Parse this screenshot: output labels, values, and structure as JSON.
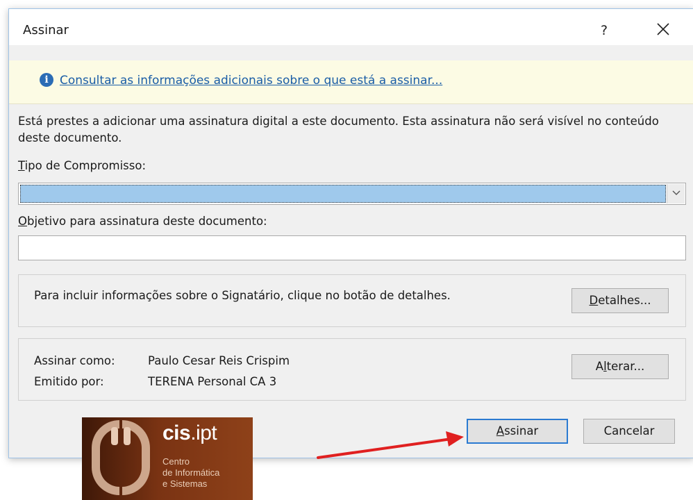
{
  "dialog": {
    "title": "Assinar",
    "help_label": "?"
  },
  "infobar": {
    "link_text": "Consultar as informações adicionais sobre o que está a assinar..."
  },
  "description": "Está prestes a adicionar uma assinatura digital a este documento. Esta assinatura não será visível no conteúdo deste documento.",
  "commitment": {
    "label_accel": "T",
    "label_rest": "ipo de Compromisso:",
    "value": ""
  },
  "purpose": {
    "label_accel": "O",
    "label_rest": "bjetivo para assinatura deste documento:",
    "value": ""
  },
  "signer_details": {
    "text": "Para incluir informações sobre o Signatário, clique no botão de detalhes.",
    "button_accel": "D",
    "button_rest": "etalhes..."
  },
  "certificate": {
    "sign_as_label": "Assinar como:",
    "sign_as_value": "Paulo Cesar Reis Crispim",
    "issued_by_label": "Emitido por:",
    "issued_by_value": "TERENA Personal CA 3",
    "change_before": "A",
    "change_accel": "l",
    "change_after": "terar..."
  },
  "buttons": {
    "sign_accel": "A",
    "sign_rest": "ssinar",
    "cancel": "Cancelar"
  },
  "logo": {
    "brand_bold": "cis",
    "brand_rest": ".ipt",
    "line1": "Centro",
    "line2": "de Informática",
    "line3": "e Sistemas"
  },
  "colors": {
    "arrow": "#e02020",
    "accent": "#2a7ad1",
    "link": "#1a5da6",
    "infobar_bg": "#fcfbe4",
    "selection": "#9fc9ec"
  }
}
